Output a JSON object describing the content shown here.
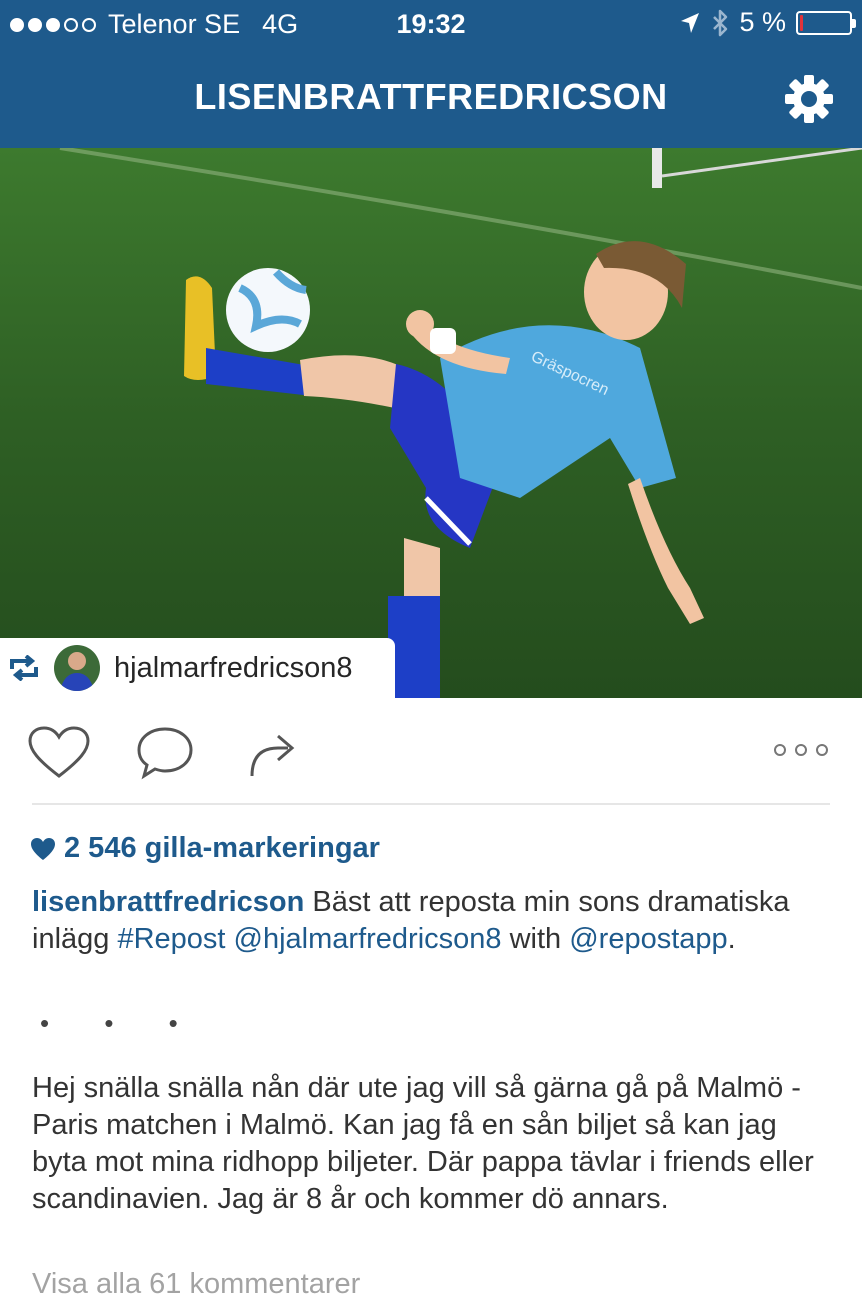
{
  "status_bar": {
    "carrier": "Telenor SE",
    "network": "4G",
    "time": "19:32",
    "battery": "5 %",
    "battery_level": 0.05,
    "signal_bars_filled": 3,
    "signal_bars_total": 5
  },
  "nav": {
    "title": "LISENBRATTFREDRICSON",
    "settings_icon": "gear-icon"
  },
  "repost": {
    "username": "hjalmarfredricson8",
    "icon": "repost-icon"
  },
  "actions": {
    "like_icon": "heart-icon",
    "comment_icon": "comment-icon",
    "share_icon": "share-icon",
    "more_icon": "more-dots-icon"
  },
  "likes": {
    "text": "2 546 gilla-markeringar"
  },
  "caption": {
    "username": "lisenbrattfredricson",
    "text_1": "Bäst att reposta min sons dramatiska inlägg",
    "hashtag": "#Repost",
    "mention_1": "@hjalmarfredricson8",
    "text_2": "with",
    "mention_2": "@repostapp",
    "text_3": "."
  },
  "ellipsis": "• • •",
  "story": "Hej snälla snälla nån där ute jag vill så gärna gå på Malmö - Paris matchen i Malmö. Kan jag få en sån biljet så kan jag byta mot mina ridhopp biljeter. Där pappa tävlar i friends eller scandinavien. Jag är 8 år och kommer dö annars.",
  "view_comments": "Visa alla 61 kommentarer",
  "colors": {
    "brand": "#1e5a8c",
    "battery_low": "#e2333a",
    "grass": "#2e5c27",
    "jersey": "#4fa8dd"
  }
}
